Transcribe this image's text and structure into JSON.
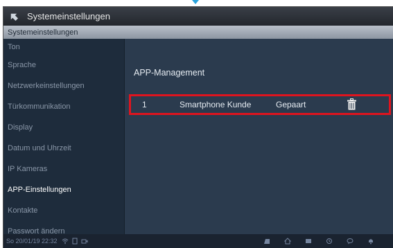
{
  "header": {
    "title": "Systemeinstellungen",
    "subtitle": "Systemeinstellungen"
  },
  "sidebar": {
    "items": [
      {
        "label": "Ton"
      },
      {
        "label": "Sprache"
      },
      {
        "label": "Netzwerkeinstellungen"
      },
      {
        "label": "Türkommunikation"
      },
      {
        "label": "Display"
      },
      {
        "label": "Datum und Uhrzeit"
      },
      {
        "label": "IP Kameras"
      },
      {
        "label": "APP-Einstellungen",
        "active": true
      },
      {
        "label": "Kontakte"
      },
      {
        "label": "Passwort ändern"
      }
    ]
  },
  "main": {
    "title": "APP-Management",
    "rows": [
      {
        "number": "1",
        "name": "Smartphone Kunde",
        "status": "Gepaart"
      }
    ]
  },
  "statusbar": {
    "datetime": "So 20/01/19  22:32"
  },
  "colors": {
    "background": "#2b3b4e",
    "sidebar": "#1e2c3c",
    "highlight": "#e0141e"
  },
  "icons": [
    "back-arrow-icon",
    "trash-icon",
    "wifi-icon",
    "door-icon",
    "camera-icon",
    "home-icon",
    "mail-icon",
    "history-icon",
    "chat-icon",
    "bell-icon"
  ]
}
